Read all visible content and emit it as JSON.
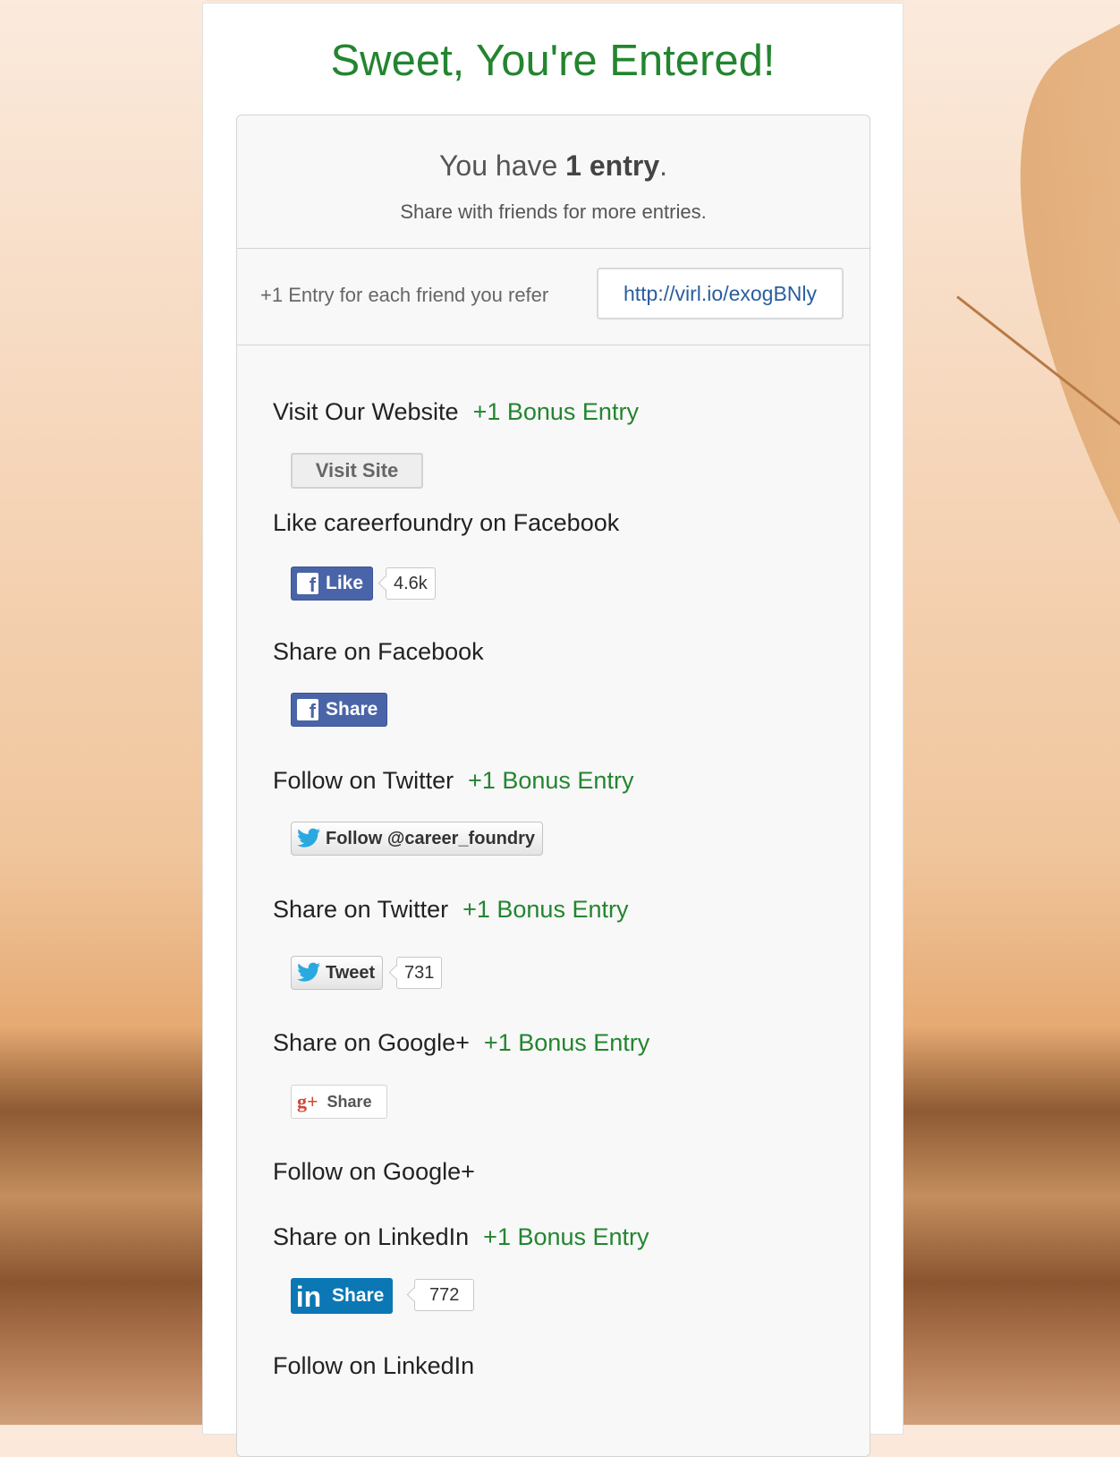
{
  "header": {
    "title": "Sweet, You're Entered!"
  },
  "summary": {
    "prefix": "You have",
    "count_text": "1 entry",
    "suffix": ".",
    "subtitle": "Share with friends for more entries."
  },
  "referral": {
    "label": "+1 Entry for each friend you refer",
    "link": "http://virl.io/exogBNly"
  },
  "actions": [
    {
      "label": "Visit Our Website",
      "bonus": "+1 Bonus Entry",
      "button": "Visit Site"
    },
    {
      "label": "Like careerfoundry on Facebook",
      "bonus": "",
      "button": "Like",
      "count": "4.6k"
    },
    {
      "label": "Share on Facebook",
      "bonus": "",
      "button": "Share"
    },
    {
      "label": "Follow on Twitter",
      "bonus": "+1 Bonus Entry",
      "button": "Follow @career_foundry"
    },
    {
      "label": "Share on Twitter",
      "bonus": "+1 Bonus Entry",
      "button": "Tweet",
      "count": "731"
    },
    {
      "label": "Share on Google+",
      "bonus": "+1 Bonus Entry",
      "button": "Share"
    },
    {
      "label": "Follow on Google+",
      "bonus": ""
    },
    {
      "label": "Share on LinkedIn",
      "bonus": "+1 Bonus Entry",
      "button": "Share",
      "count": "772"
    },
    {
      "label": "Follow on LinkedIn",
      "bonus": ""
    }
  ],
  "icons": {
    "facebook": "facebook-icon",
    "twitter": "twitter-bird-icon",
    "googleplus": "google-plus-icon",
    "linkedin": "linkedin-icon"
  },
  "colors": {
    "accent_green": "#23852f",
    "facebook_blue": "#4a64a8",
    "linkedin_blue": "#0b77b5",
    "twitter_blue": "#2aa9e0",
    "link_blue": "#2a5d9e"
  }
}
